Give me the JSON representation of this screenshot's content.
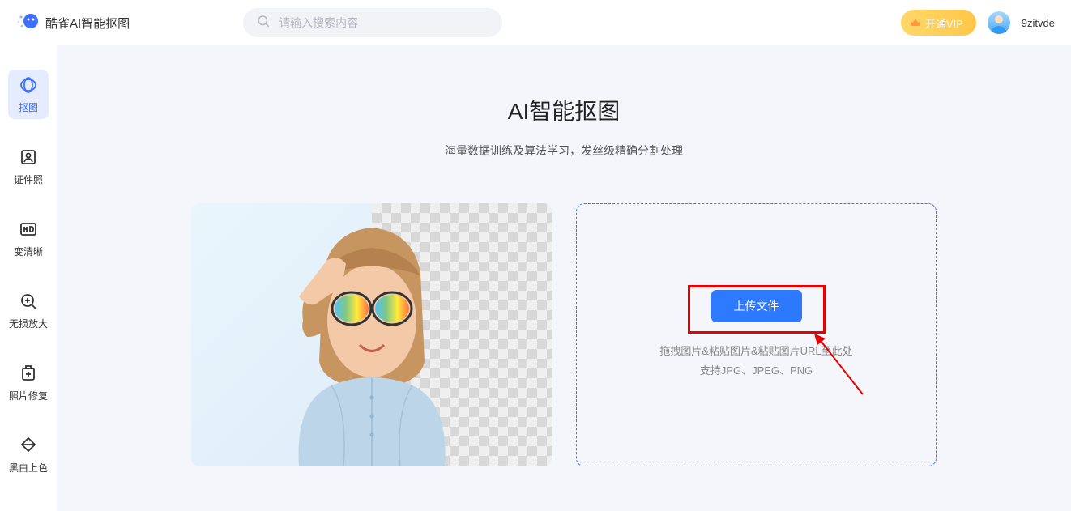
{
  "header": {
    "app_title": "酷雀AI智能抠图",
    "search_placeholder": "请输入搜索内容",
    "vip_label": "开通VIP",
    "username": "9zitvde"
  },
  "sidebar": {
    "items": [
      {
        "label": "抠图"
      },
      {
        "label": "证件照"
      },
      {
        "label": "变清晰"
      },
      {
        "label": "无损放大"
      },
      {
        "label": "照片修复"
      },
      {
        "label": "黑白上色"
      }
    ]
  },
  "main": {
    "title": "AI智能抠图",
    "subtitle": "海量数据训练及算法学习，发丝级精确分割处理",
    "upload_button": "上传文件",
    "hint_line1": "拖拽图片&粘贴图片&粘贴图片URL至此处",
    "hint_line2": "支持JPG、JPEG、PNG"
  }
}
